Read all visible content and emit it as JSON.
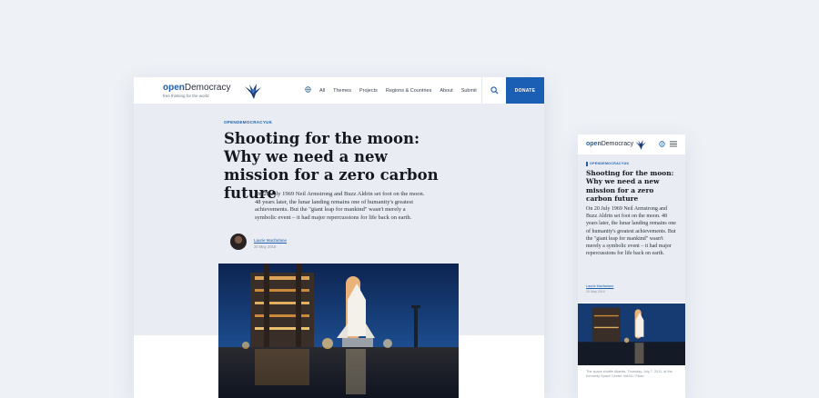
{
  "desktop": {
    "logo": {
      "open": "open",
      "democracy": "Democracy",
      "tagline": "free thinking for the world"
    },
    "nav": [
      "All",
      "Themes",
      "Projects",
      "Regions & Countries",
      "About",
      "Submit"
    ],
    "donate_label": "DONATE",
    "article": {
      "kicker": "OPENDEMOCRACYUK",
      "title": "Shooting for the moon: Why we need a new mission for a zero carbon future",
      "lede": "On 20 July 1969 Neil Armstrong and Buzz Aldrin set foot on the moon. 48 years later, the lunar landing remains one of humanity's greatest achievements. But the \"giant leap for mankind\" wasn't merely a symbolic event – it had major repercussions for life back on earth.",
      "author": "Laurie Macfarlane",
      "date": "20 May 2018"
    }
  },
  "mobile": {
    "logo": {
      "open": "open",
      "democracy": "Democracy"
    },
    "article": {
      "kicker": "OPENDEMOCRACYUK",
      "title": "Shooting for the moon: Why we need a new mission for a zero carbon future",
      "lede": "On 20 July 1969 Neil Armstrong and Buzz Aldrin set foot on the moon. 48 years later, the lunar landing remains one of humanity's greatest achievements. But the \"giant leap for mankind\" wasn't merely a symbolic event – it had major repercussions for life back on earth.",
      "author": "Laurie Macfarlane",
      "date": "20 May 2018",
      "caption": "The space shuttle Atlantis, Thursday, July 7, 2011, at the Kennedy Space Center. NASA / Flickr."
    }
  },
  "colors": {
    "brand": "#1d5fa8",
    "donate": "#1a5fb4",
    "background": "#eef1f6"
  }
}
